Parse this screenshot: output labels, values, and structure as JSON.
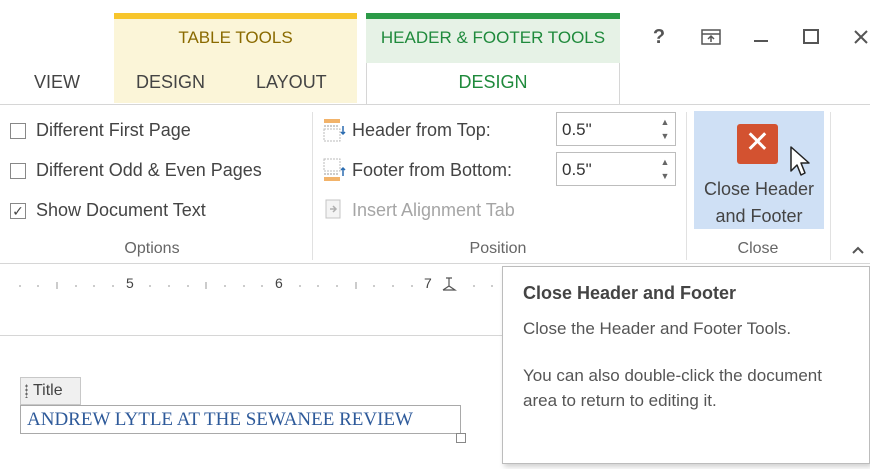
{
  "contextual_tabs": {
    "table_tools": "TABLE TOOLS",
    "header_footer_tools": "HEADER & FOOTER TOOLS"
  },
  "tabs": {
    "view": "VIEW",
    "table_design": "DESIGN",
    "table_layout": "LAYOUT",
    "hf_design": "DESIGN"
  },
  "window_controls": {
    "help": "?",
    "ribbon_display": "ribbon-display-icon",
    "minimize": "minimize-icon",
    "maximize": "maximize-icon",
    "close": "close-icon"
  },
  "options_group": {
    "label": "Options",
    "items": [
      {
        "label": "Different First Page",
        "checked": false
      },
      {
        "label": "Different Odd & Even Pages",
        "checked": false
      },
      {
        "label": "Show Document Text",
        "checked": true
      }
    ]
  },
  "position_group": {
    "label": "Position",
    "header_from_top_label": "Header from Top:",
    "header_from_top_value": "0.5\"",
    "footer_from_bottom_label": "Footer from Bottom:",
    "footer_from_bottom_value": "0.5\"",
    "insert_alignment_tab": "Insert Alignment Tab"
  },
  "close_group": {
    "label": "Close",
    "button_line1": "Close Header",
    "button_line2": "and Footer"
  },
  "ruler": {
    "numbers": [
      "5",
      "6",
      "7"
    ]
  },
  "document": {
    "title_tag": "Title",
    "title_text": "ANDREW LYTLE AT THE SEWANEE REVIEW"
  },
  "tooltip": {
    "title": "Close Header and Footer",
    "line1": "Close the Header and Footer Tools.",
    "line2": "You can also double-click the document area to return to editing it."
  },
  "colors": {
    "table_tools_accent": "#f7c52b",
    "hf_tools_accent": "#2b9a47",
    "close_icon": "#d35230",
    "close_button_hover": "#cfe0f5",
    "document_title": "#2e5a9a"
  }
}
